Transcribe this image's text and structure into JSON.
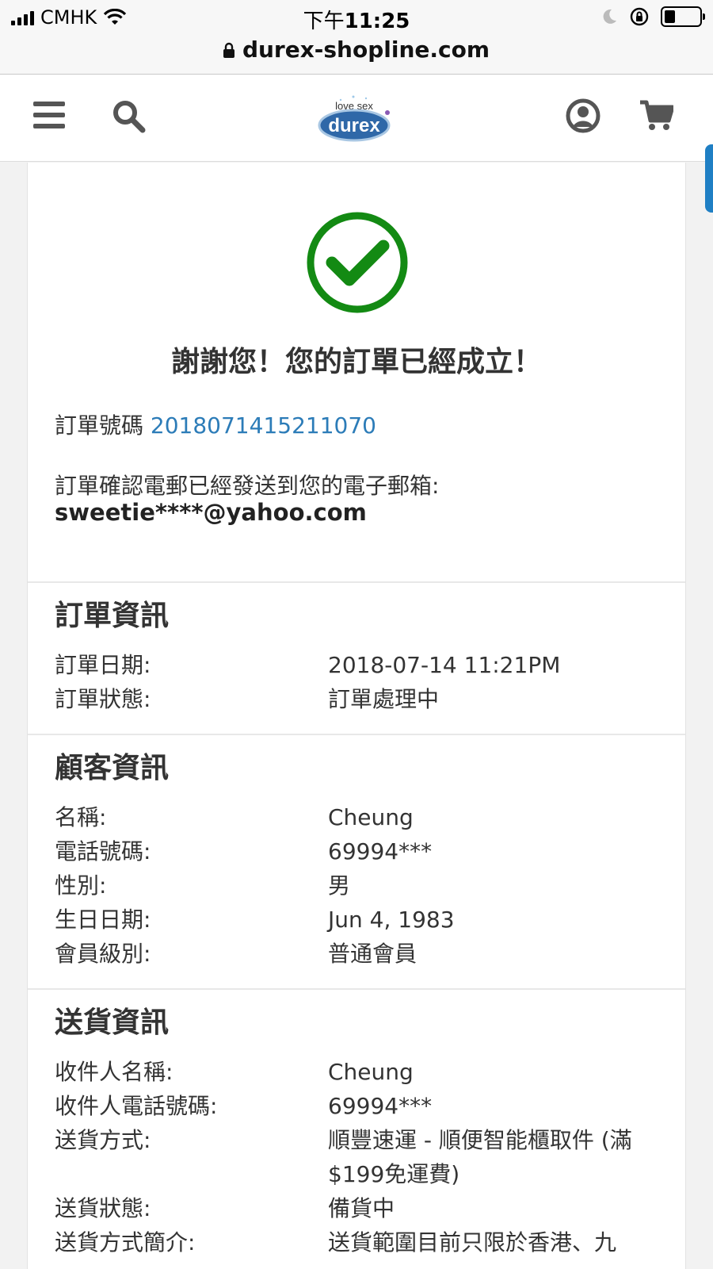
{
  "status_bar": {
    "carrier": "CMHK",
    "time_prefix": "下午",
    "time": "11:25",
    "battery_level": 0.3
  },
  "url_bar": {
    "domain": "durex-shopline.com"
  },
  "header": {
    "logo_tagline": "love sex",
    "logo_text": "durex",
    "icons": [
      "menu-icon",
      "search-icon",
      "account-icon",
      "cart-icon"
    ]
  },
  "confirmation": {
    "title": "謝謝您！您的訂單已經成立！",
    "order_number_label": "訂單號碼",
    "order_number": "2018071415211070",
    "email_notice": "訂單確認電郵已經發送到您的電子郵箱:",
    "email": "sweetie****@yahoo.com",
    "success_color": "#138a13"
  },
  "order_info": {
    "heading": "訂單資訊",
    "rows": [
      {
        "label": "訂單日期:",
        "value": "2018-07-14 11:21PM"
      },
      {
        "label": "訂單狀態:",
        "value": "訂單處理中"
      }
    ]
  },
  "customer_info": {
    "heading": "顧客資訊",
    "rows": [
      {
        "label": "名稱:",
        "value": "Cheung"
      },
      {
        "label": "電話號碼:",
        "value": "69994***"
      },
      {
        "label": "性別:",
        "value": "男"
      },
      {
        "label": "生日日期:",
        "value": "Jun 4, 1983"
      },
      {
        "label": "會員級別:",
        "value": "普通會員"
      }
    ]
  },
  "delivery_info": {
    "heading": "送貨資訊",
    "rows": [
      {
        "label": "收件人名稱:",
        "value": "Cheung"
      },
      {
        "label": "收件人電話號碼:",
        "value": "69994***"
      },
      {
        "label": "送貨方式:",
        "value": "順豐速運 - 順便智能櫃取件 (滿$199免運費)"
      },
      {
        "label": "送貨狀態:",
        "value": "備貨中"
      },
      {
        "label": "送貨方式簡介:",
        "value": "送貨範圍目前只限於香港、九"
      }
    ]
  }
}
